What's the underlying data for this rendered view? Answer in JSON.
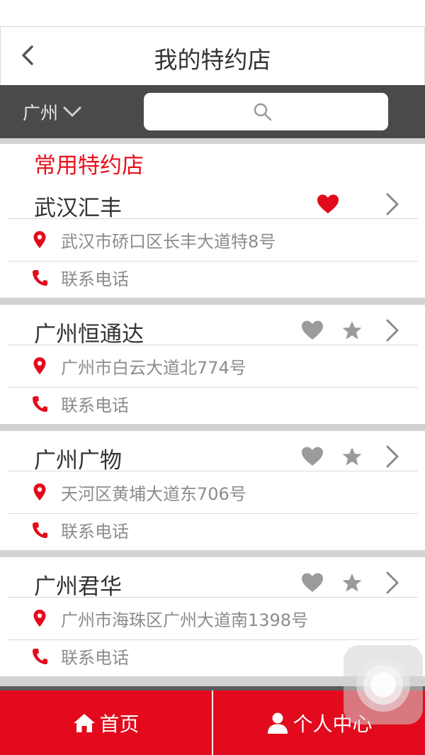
{
  "colors": {
    "accent": "#e20a1c",
    "header_bar": "#4a4a4a",
    "divider": "#d2d2d2",
    "icon_grey": "#9b9b9b"
  },
  "header": {
    "title": "我的特约店",
    "back_icon": "chevron-left-icon"
  },
  "filter": {
    "city": "广州",
    "search_placeholder": "",
    "search_value": ""
  },
  "section": {
    "title": "常用特约店"
  },
  "stores": [
    {
      "name": "武汉汇丰",
      "address": "武汉市硚口区长丰大道特8号",
      "phone_label": "联系电话",
      "favorited": true,
      "show_star": false
    },
    {
      "name": "广州恒通达",
      "address": "广州市白云大道北774号",
      "phone_label": "联系电话",
      "favorited": false,
      "show_star": true
    },
    {
      "name": "广州广物",
      "address": "天河区黄埔大道东706号",
      "phone_label": "联系电话",
      "favorited": false,
      "show_star": true
    },
    {
      "name": "广州君华",
      "address": "广州市海珠区广州大道南1398号",
      "phone_label": "联系电话",
      "favorited": false,
      "show_star": true
    }
  ],
  "tabbar": {
    "home": "首页",
    "profile": "个人中心"
  }
}
